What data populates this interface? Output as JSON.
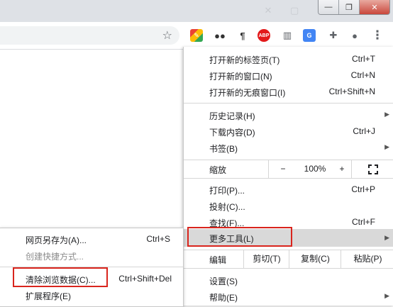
{
  "window": {
    "minimize_label": "—",
    "maximize_label": "❐",
    "close_label": "✕"
  },
  "toolbar": {
    "bookmark_icon": "star-icon",
    "extensions": [
      {
        "name": "google-keep-icon",
        "glyph": "✎",
        "color": "#f4b400"
      },
      {
        "name": "tampermonkey-icon",
        "glyph": "●●",
        "color": "#333333"
      },
      {
        "name": "text-formatting-icon",
        "glyph": "¶",
        "color": "#333333"
      },
      {
        "name": "adblock-plus-icon",
        "glyph": "ABP",
        "color": "#e3191a"
      },
      {
        "name": "reader-mode-icon",
        "glyph": "▥",
        "color": "#5f6368"
      },
      {
        "name": "google-translate-icon",
        "glyph": "G",
        "color": "#4285f4"
      },
      {
        "name": "extensions-puzzle-icon",
        "glyph": "✚",
        "color": "#5f6368"
      },
      {
        "name": "profile-avatar-icon",
        "glyph": "●",
        "color": "#5f6368"
      },
      {
        "name": "kebab-menu-icon",
        "glyph": "⋮",
        "color": "#5f6368"
      }
    ]
  },
  "menu": {
    "new_tab": {
      "label": "打开新的标签页(T)",
      "shortcut": "Ctrl+T"
    },
    "new_window": {
      "label": "打开新的窗口(N)",
      "shortcut": "Ctrl+N"
    },
    "new_incognito": {
      "label": "打开新的无痕窗口(I)",
      "shortcut": "Ctrl+Shift+N"
    },
    "history": {
      "label": "历史记录(H)"
    },
    "downloads": {
      "label": "下载内容(D)",
      "shortcut": "Ctrl+J"
    },
    "bookmarks": {
      "label": "书签(B)"
    },
    "zoom": {
      "label": "缩放",
      "minus": "−",
      "value": "100%",
      "plus": "+"
    },
    "print": {
      "label": "打印(P)...",
      "shortcut": "Ctrl+P"
    },
    "cast": {
      "label": "投射(C)..."
    },
    "find": {
      "label": "查找(F)...",
      "shortcut": "Ctrl+F"
    },
    "more_tools": {
      "label": "更多工具(L)"
    },
    "edit": {
      "label": "编辑",
      "cut": "剪切(T)",
      "copy": "复制(C)",
      "paste": "粘贴(P)"
    },
    "settings": {
      "label": "设置(S)"
    },
    "help": {
      "label": "帮助(E)"
    }
  },
  "submenu": {
    "save_page": {
      "label": "网页另存为(A)...",
      "shortcut": "Ctrl+S"
    },
    "create_shortcut": {
      "label": "创建快捷方式..."
    },
    "clear_data": {
      "label": "清除浏览数据(C)...",
      "shortcut": "Ctrl+Shift+Del"
    },
    "extensions": {
      "label": "扩展程序(E)"
    }
  },
  "colors": {
    "highlight_box": "#d9251d",
    "hover_row": "#d9d9d9"
  }
}
